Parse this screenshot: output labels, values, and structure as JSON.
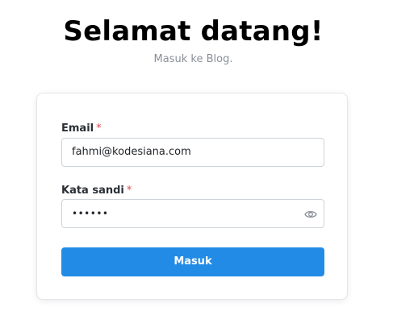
{
  "header": {
    "title": "Selamat datang!",
    "subtitle": "Masuk ke Blog."
  },
  "form": {
    "email_label": "Email",
    "email_value": "fahmi@kodesiana.com",
    "password_label": "Kata sandi",
    "password_value": "••••••",
    "required_marker": "*",
    "submit_label": "Masuk"
  },
  "colors": {
    "accent": "#228be6",
    "required": "#e0474c"
  },
  "icons": {
    "password_toggle": "eye-icon"
  }
}
